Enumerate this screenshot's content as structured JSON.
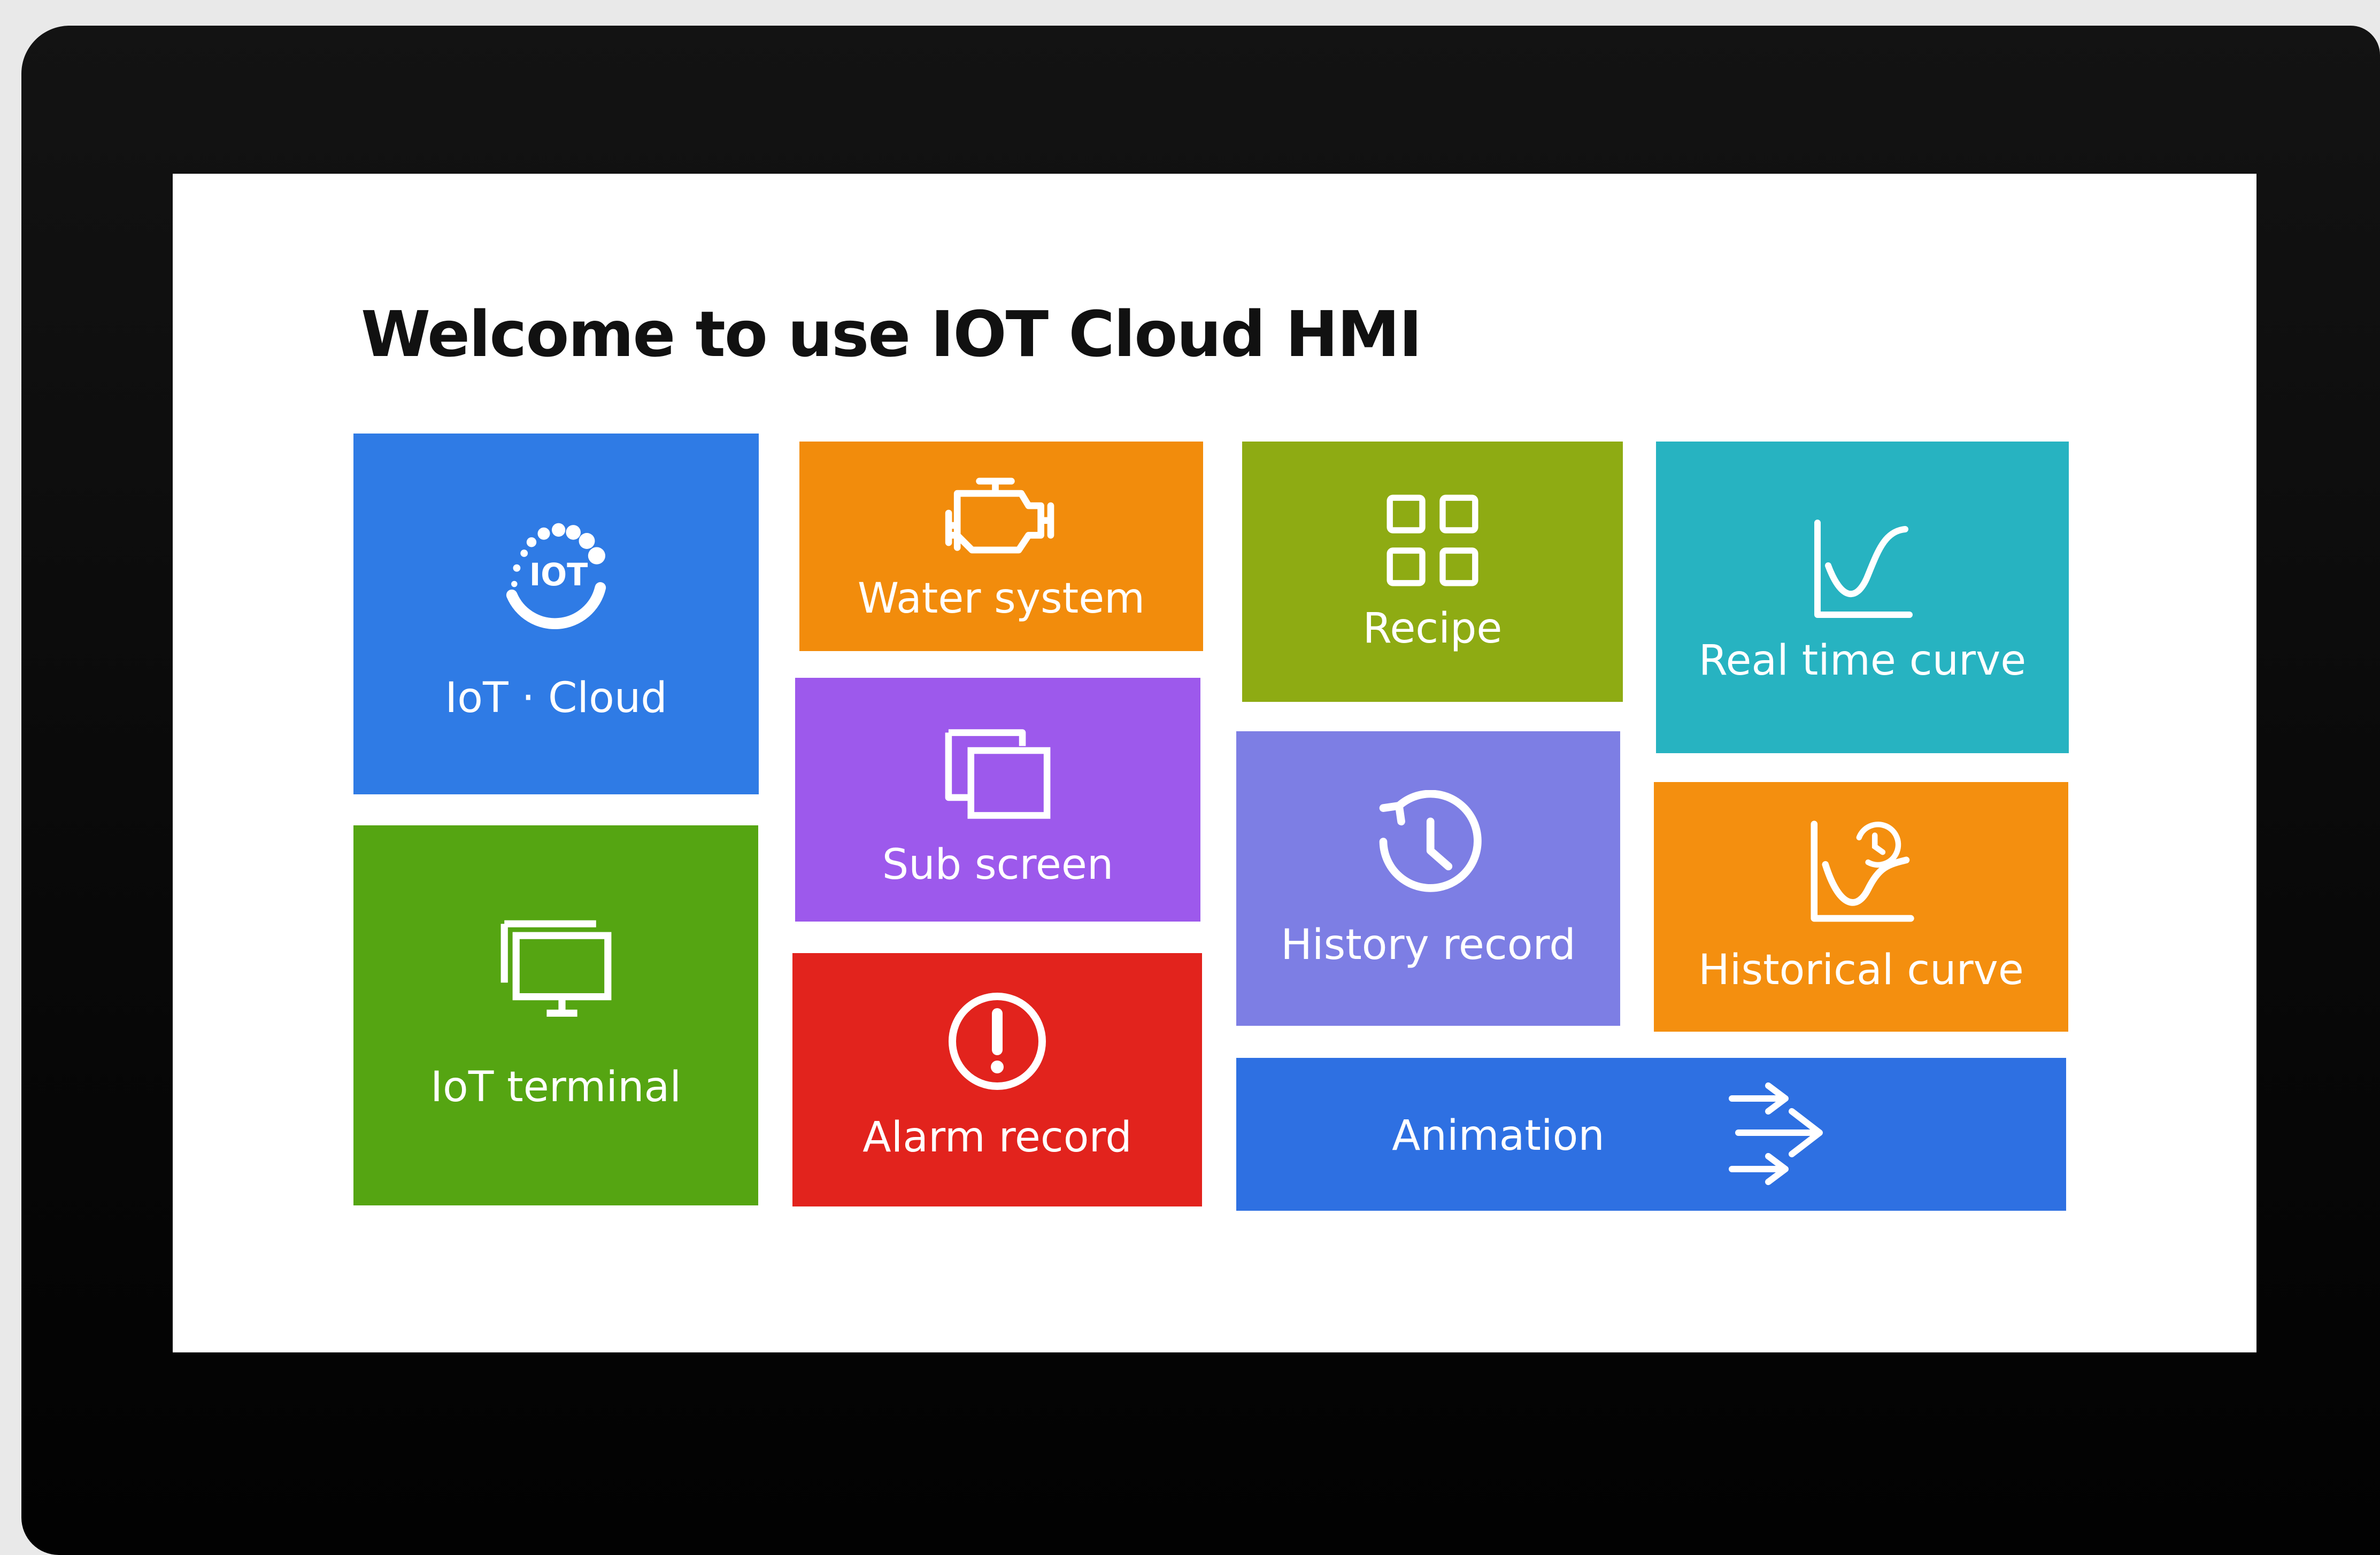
{
  "screen": {
    "title": "Welcome to use IOT Cloud HMI"
  },
  "tiles": {
    "iot_cloud": {
      "label": "IoT · Cloud",
      "icon": "iot-cloud-logo-icon",
      "color": "#2f7be5",
      "logo_text": "IOT"
    },
    "water_system": {
      "label": "Water system",
      "icon": "engine-icon",
      "color": "#f28c0c"
    },
    "recipe": {
      "label": "Recipe",
      "icon": "grid-icon",
      "color": "#8eab13"
    },
    "real_time_curve": {
      "label": "Real time curve",
      "icon": "line-chart-icon",
      "color": "#27b3c1"
    },
    "sub_screen": {
      "label": "Sub screen",
      "icon": "windows-icon",
      "color": "#9d59ec"
    },
    "history_record": {
      "label": "History record",
      "icon": "history-clock-icon",
      "color": "#7d7ee4"
    },
    "historical_curve": {
      "label": "Historical curve",
      "icon": "history-chart-icon",
      "color": "#f48f0f"
    },
    "iot_terminal": {
      "label": "IoT terminal",
      "icon": "monitor-icon",
      "color": "#55a512"
    },
    "alarm_record": {
      "label": "Alarm record",
      "icon": "alert-icon",
      "color": "#e2231d"
    },
    "animation": {
      "label": "Animation",
      "icon": "arrows-right-icon",
      "color": "#2e70e2"
    }
  }
}
